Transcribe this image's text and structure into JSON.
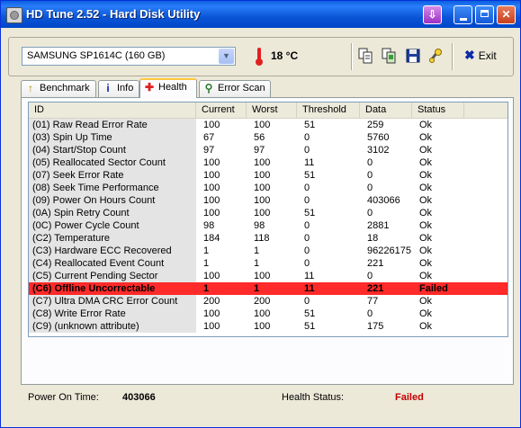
{
  "window": {
    "title": "HD Tune 2.52 - Hard Disk Utility"
  },
  "toolbar": {
    "drive": "SAMSUNG SP1614C (160 GB)",
    "temperature": "18 °C",
    "exit_label": "Exit",
    "icons": [
      "copy-text-icon",
      "copy-screenshot-icon",
      "save-icon",
      "options-icon"
    ]
  },
  "tabs": [
    {
      "label": "Benchmark",
      "icon": "benchmark-icon",
      "active": false
    },
    {
      "label": "Info",
      "icon": "info-icon",
      "active": false
    },
    {
      "label": "Health",
      "icon": "health-cross-icon",
      "active": true
    },
    {
      "label": "Error Scan",
      "icon": "magnifier-icon",
      "active": false
    }
  ],
  "table": {
    "headers": [
      "ID",
      "Current",
      "Worst",
      "Threshold",
      "Data",
      "Status"
    ],
    "rows": [
      [
        "(01) Raw Read Error Rate",
        "100",
        "100",
        "51",
        "259",
        "Ok"
      ],
      [
        "(03) Spin Up Time",
        "67",
        "56",
        "0",
        "5760",
        "Ok"
      ],
      [
        "(04) Start/Stop Count",
        "97",
        "97",
        "0",
        "3102",
        "Ok"
      ],
      [
        "(05) Reallocated Sector Count",
        "100",
        "100",
        "11",
        "0",
        "Ok"
      ],
      [
        "(07) Seek Error Rate",
        "100",
        "100",
        "51",
        "0",
        "Ok"
      ],
      [
        "(08) Seek Time Performance",
        "100",
        "100",
        "0",
        "0",
        "Ok"
      ],
      [
        "(09) Power On Hours Count",
        "100",
        "100",
        "0",
        "403066",
        "Ok"
      ],
      [
        "(0A) Spin Retry Count",
        "100",
        "100",
        "51",
        "0",
        "Ok"
      ],
      [
        "(0C) Power Cycle Count",
        "98",
        "98",
        "0",
        "2881",
        "Ok"
      ],
      [
        "(C2) Temperature",
        "184",
        "118",
        "0",
        "18",
        "Ok"
      ],
      [
        "(C3) Hardware ECC Recovered",
        "1",
        "1",
        "0",
        "96226175",
        "Ok"
      ],
      [
        "(C4) Reallocated Event Count",
        "1",
        "1",
        "0",
        "221",
        "Ok"
      ],
      [
        "(C5) Current Pending Sector",
        "100",
        "100",
        "11",
        "0",
        "Ok"
      ],
      [
        "(C6) Offline Uncorrectable",
        "1",
        "1",
        "11",
        "221",
        "Failed"
      ],
      [
        "(C7) Ultra DMA CRC Error Count",
        "200",
        "200",
        "0",
        "77",
        "Ok"
      ],
      [
        "(C8) Write Error Rate",
        "100",
        "100",
        "51",
        "0",
        "Ok"
      ],
      [
        "(C9) (unknown attribute)",
        "100",
        "100",
        "51",
        "175",
        "Ok"
      ]
    ]
  },
  "footer": {
    "power_on_label": "Power On Time:",
    "power_on_value": "403066",
    "health_label": "Health Status:",
    "health_value": "Failed"
  },
  "colors": {
    "failed_row": "#ff2a2a",
    "failed_text": "#c00000",
    "titlebar": "#0a5fe0"
  }
}
